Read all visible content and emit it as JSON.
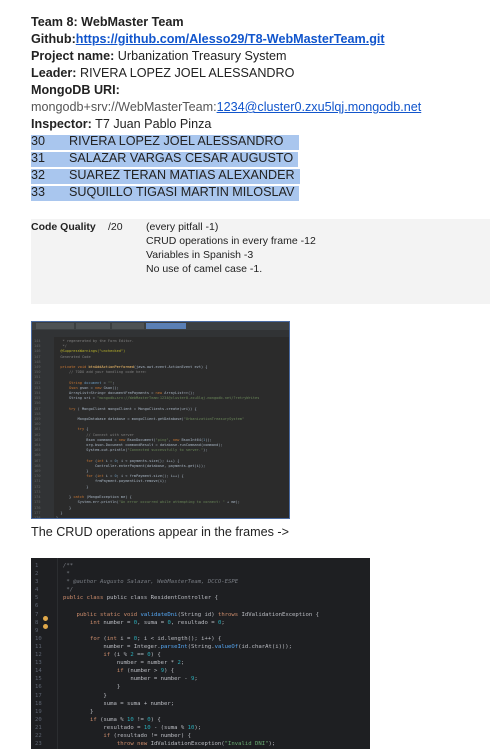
{
  "header": {
    "team_line": "Team 8: WebMaster Team",
    "github_label": "Github:",
    "github_url": "https://github.com/Alesso29/T8-WebMasterTeam.git",
    "project_label": "Project name:",
    "project_value": "Urbanization Treasury System",
    "leader_label": "Leader:",
    "leader_value": "RIVERA LOPEZ JOEL ALESSANDRO",
    "mongo_label": "MongoDB URI:",
    "mongo_prefix": "mongodb+srv://WebMasterTeam:",
    "mongo_link": "1234@cluster0.zxu5lqj.mongodb.net",
    "inspector_label": "Inspector:",
    "inspector_value": "T7 Juan Pablo Pinza"
  },
  "members": [
    {
      "num": "30",
      "name": "RIVERA LOPEZ JOEL ALESSANDRO"
    },
    {
      "num": "31",
      "name": "SALAZAR VARGAS CESAR AUGUSTO"
    },
    {
      "num": "32",
      "name": "SUAREZ TERAN MATIAS ALEXANDER"
    },
    {
      "num": "33",
      "name": "SUQUILLO TIGASI MARTIN MILOSLAV"
    }
  ],
  "code_quality": {
    "label": "Code Quality",
    "score": "/20",
    "rules": [
      "(every pitfall -1)",
      "CRUD operations in every frame -12",
      "Variables in Spanish -3",
      "No use of camel case -1."
    ]
  },
  "caption": "The CRUD operations appear in the frames ->",
  "screenshot2": {
    "comment_author": " * @author Augusto Salazar, WebMasterTeam, DCCO-ESPE",
    "class_decl": "public class ResidentController {",
    "method_decl": "public static void validateDni(String id) throws IdValidationException {",
    "exception_msg": "\"Invalid DNI\""
  }
}
